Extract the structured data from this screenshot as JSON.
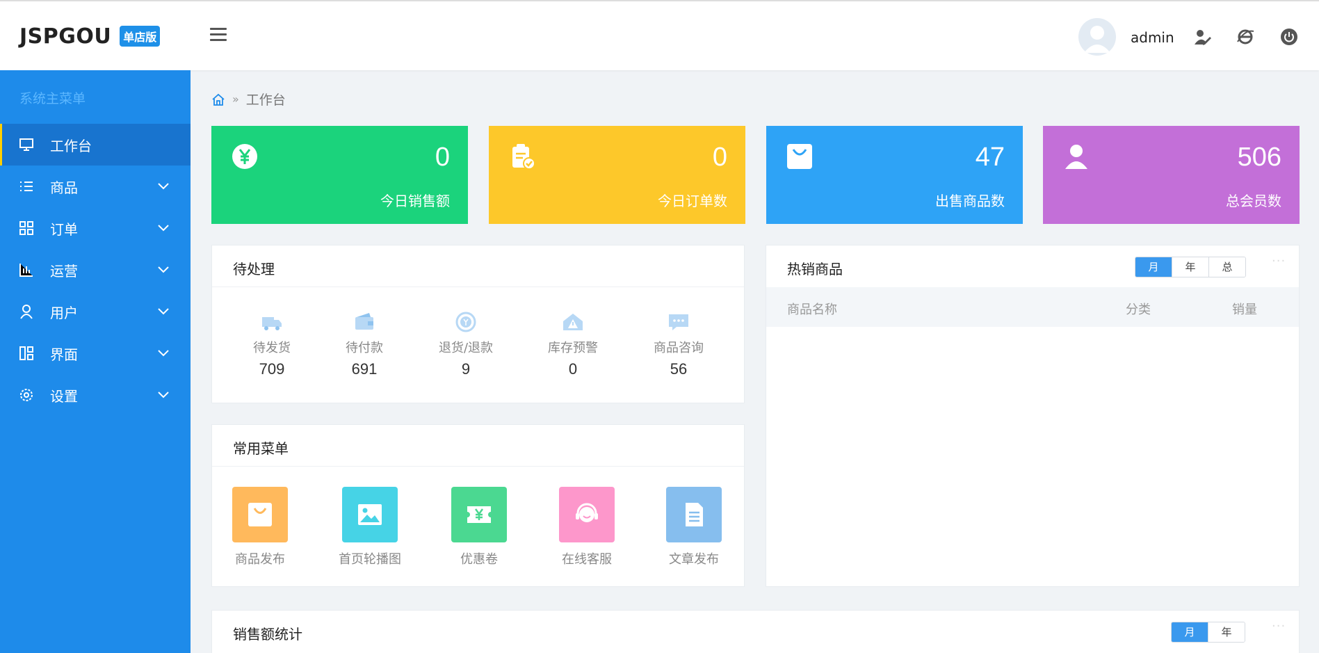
{
  "header": {
    "logo_text": "JSPGOU",
    "logo_badge": "单店版",
    "username": "admin"
  },
  "sidebar": {
    "title": "系统主菜单",
    "items": [
      {
        "label": "工作台",
        "icon": "monitor-icon"
      },
      {
        "label": "商品",
        "icon": "list-icon"
      },
      {
        "label": "订单",
        "icon": "grid-icon"
      },
      {
        "label": "运营",
        "icon": "bar-chart-icon"
      },
      {
        "label": "用户",
        "icon": "user-icon"
      },
      {
        "label": "界面",
        "icon": "layout-icon"
      },
      {
        "label": "设置",
        "icon": "gear-icon"
      }
    ]
  },
  "breadcrumb": {
    "current": "工作台"
  },
  "stats": [
    {
      "value": "0",
      "label": "今日销售额",
      "color": "#1bd37c"
    },
    {
      "value": "0",
      "label": "今日订单数",
      "color": "#fdc82a"
    },
    {
      "value": "47",
      "label": "出售商品数",
      "color": "#2ea3f6"
    },
    {
      "value": "506",
      "label": "总会员数",
      "color": "#c36fd8"
    }
  ],
  "pending": {
    "title": "待处理",
    "items": [
      {
        "label": "待发货",
        "value": "709"
      },
      {
        "label": "待付款",
        "value": "691"
      },
      {
        "label": "退货/退款",
        "value": "9"
      },
      {
        "label": "库存预警",
        "value": "0"
      },
      {
        "label": "商品咨询",
        "value": "56"
      }
    ]
  },
  "quick_menu": {
    "title": "常用菜单",
    "items": [
      {
        "label": "商品发布",
        "color": "#ffb95c"
      },
      {
        "label": "首页轮播图",
        "color": "#46d3e6"
      },
      {
        "label": "优惠卷",
        "color": "#4bd891"
      },
      {
        "label": "在线客服",
        "color": "#fd97cb"
      },
      {
        "label": "文章发布",
        "color": "#86beee"
      }
    ]
  },
  "hot_products": {
    "title": "热销商品",
    "tabs": [
      "月",
      "年",
      "总"
    ],
    "active_tab": "月",
    "columns": [
      "商品名称",
      "分类",
      "销量"
    ]
  },
  "sales_stats": {
    "title": "销售额统计",
    "tabs": [
      "月",
      "年"
    ],
    "active_tab": "月"
  }
}
